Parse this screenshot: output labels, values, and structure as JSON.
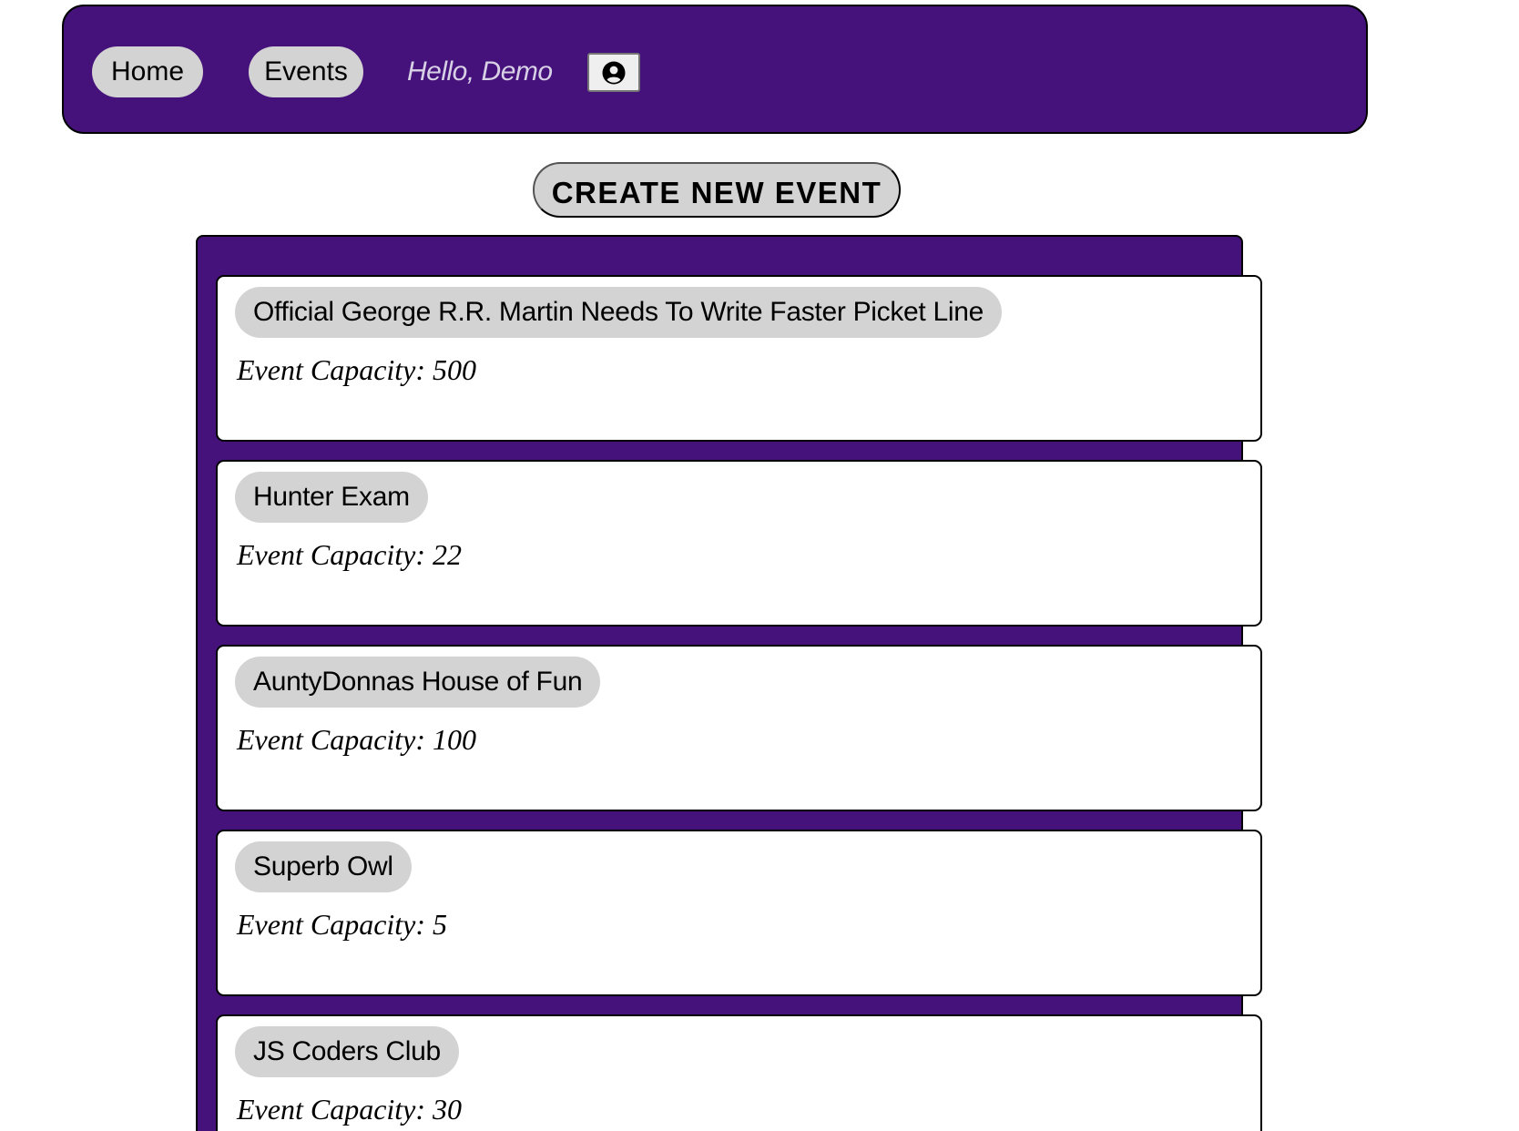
{
  "nav": {
    "home_label": "Home",
    "events_label": "Events",
    "greeting": "Hello, Demo",
    "profile_icon": "user-circle-icon"
  },
  "create_button_label": "CREATE NEW EVENT",
  "events": [
    {
      "title": "Official George R.R. Martin Needs To Write Faster Picket Line",
      "capacity": "Event Capacity: 500"
    },
    {
      "title": "Hunter Exam",
      "capacity": "Event Capacity: 22"
    },
    {
      "title": "AuntyDonnas House of Fun",
      "capacity": "Event Capacity: 100"
    },
    {
      "title": "Superb Owl",
      "capacity": "Event Capacity: 5"
    },
    {
      "title": "JS Coders Club",
      "capacity": "Event Capacity: 30"
    }
  ],
  "colors": {
    "brand_purple": "#45127b",
    "pill_gray": "#d3d3d3",
    "greeting_text": "#d8d1e6"
  }
}
